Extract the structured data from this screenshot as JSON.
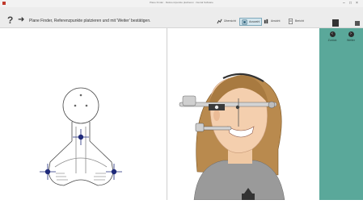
{
  "window": {
    "title": "Plane Finder · Referenzpunkte platzieren · Dental Software",
    "controls": [
      "–",
      "□",
      "×"
    ]
  },
  "toolbar": {
    "help": "?",
    "arrow": "➜",
    "instruction": "Plane Finder, Referenzpunkte platzieren und mit 'Weiter' bestätigen.",
    "tools": [
      {
        "label": "Übersicht",
        "icon": "overview-icon"
      },
      {
        "label": "Auswahl",
        "icon": "select-icon"
      },
      {
        "label": "Ansicht",
        "icon": "view-icon"
      },
      {
        "label": "Bericht",
        "icon": "report-icon"
      }
    ]
  },
  "sidebar": {
    "back_label": "Zurück",
    "next_label": "Weiter"
  },
  "colors": {
    "accent_panel": "#5aa89a",
    "point_marker": "#1f2a7a"
  }
}
